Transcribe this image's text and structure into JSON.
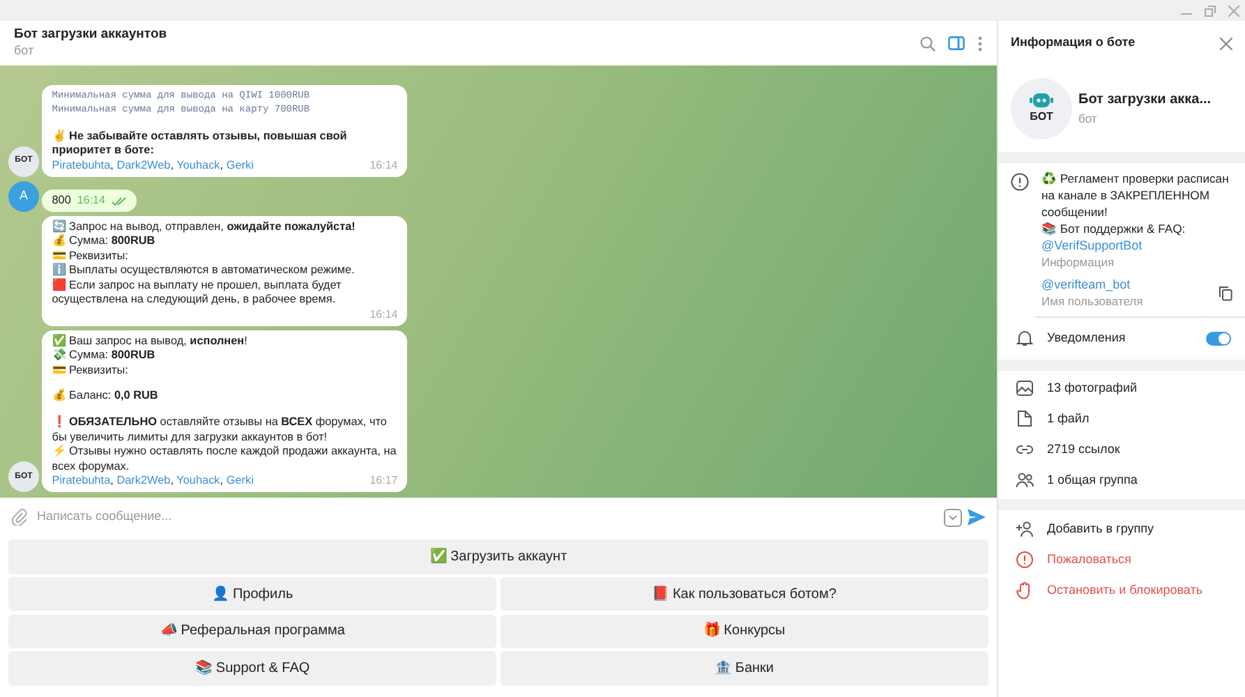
{
  "chat": {
    "title": "Бот загрузки аккаунтов",
    "subtitle": "бот"
  },
  "messages": [
    {
      "kind": "bot",
      "avatar": "БОТ",
      "lines": [
        {
          "kind": "mono",
          "text": "Минимальная сумма для вывода на QIWI 1000RUB"
        },
        {
          "kind": "mono",
          "text": "Минимальная сумма для вывода на карту 700RUB"
        },
        {
          "kind": "gap"
        },
        {
          "kind": "text",
          "text": "✌ **Не забывайте оставлять отзывы, повышая свой приоритет в боте:**"
        }
      ],
      "links": [
        "Piratebuhta",
        "Dark2Web",
        "Youhack",
        "Gerki"
      ],
      "link_separator": ",",
      "time": "16:14"
    },
    {
      "kind": "user",
      "avatar": "A",
      "text": "800",
      "time": "16:14",
      "read": true
    },
    {
      "kind": "bot",
      "lines": [
        {
          "kind": "text",
          "text": "🔄 Запрос на вывод,  отправлен, **ожидайте пожалуйста!**"
        },
        {
          "kind": "text",
          "text": "💰 Сумма: **800RUB**"
        },
        {
          "kind": "text",
          "text": "💳 Реквизиты:"
        },
        {
          "kind": "text",
          "text": "ℹ️ Выплаты осуществляются в автоматическом режиме."
        },
        {
          "kind": "text",
          "text": "🟥 Если запрос на выплату не прошел, выплата будет осуществлена на следующий день, в рабочее время."
        }
      ],
      "time": "16:14"
    },
    {
      "kind": "bot",
      "avatar": "БОТ",
      "lines": [
        {
          "kind": "text",
          "text": "✅ Ваш запрос на вывод, **исполнен**!"
        },
        {
          "kind": "text",
          "text": "💸 Сумма: **800RUB**"
        },
        {
          "kind": "text",
          "text": "💳 Реквизиты:"
        },
        {
          "kind": "gap"
        },
        {
          "kind": "text",
          "text": "💰 Баланс: **0,0 RUB**"
        },
        {
          "kind": "gap"
        },
        {
          "kind": "text",
          "text": "❗ **ОБЯЗАТЕЛЬНО** оставляйте отзывы на **ВСЕХ** форумах, что бы увеличить лимиты для загрузки аккаунтов в бот!"
        },
        {
          "kind": "text",
          "text": "⚡ Отзывы нужно оставлять после каждой продажи аккаунта, на всех форумах."
        }
      ],
      "links": [
        "Piratebuhta",
        "Dark2Web",
        "Youhack",
        "Gerki"
      ],
      "link_separator": ",",
      "time": "16:17"
    }
  ],
  "composer": {
    "placeholder": "Написать сообщение..."
  },
  "keyboard": [
    [
      "✅ Загрузить аккаунт"
    ],
    [
      "👤 Профиль",
      "📕 Как пользоваться ботом?"
    ],
    [
      "📣 Реферальная программа",
      "🎁 Конкурсы"
    ],
    [
      "📚 Support & FAQ",
      "🏦 Банки"
    ]
  ],
  "panel": {
    "title": "Информация о боте",
    "avatar": "БОТ",
    "name": "Бот загрузки акка...",
    "subtitle": "бот",
    "description": [
      "♻️ Регламент проверки расписан на канале в ЗАКРЕПЛЕННОМ сообщении!",
      "📚 Бот поддержки & FAQ:"
    ],
    "description_link": "@VerifSupportBot",
    "description_label": "Информация",
    "username": "@verifteam_bot",
    "username_label": "Имя пользователя",
    "notifications": {
      "label": "Уведомления",
      "on": true
    },
    "media": [
      {
        "kind": "photo",
        "text": "13 фотографий"
      },
      {
        "kind": "file",
        "text": "1 файл"
      },
      {
        "kind": "link",
        "text": "2719 ссылок"
      },
      {
        "kind": "group",
        "text": "1 общая группа"
      }
    ],
    "actions": [
      {
        "kind": "add",
        "text": "Добавить в группу",
        "danger": false
      },
      {
        "kind": "report",
        "text": "Пожаловаться",
        "danger": true
      },
      {
        "kind": "block",
        "text": "Остановить и блокировать",
        "danger": true
      }
    ]
  }
}
